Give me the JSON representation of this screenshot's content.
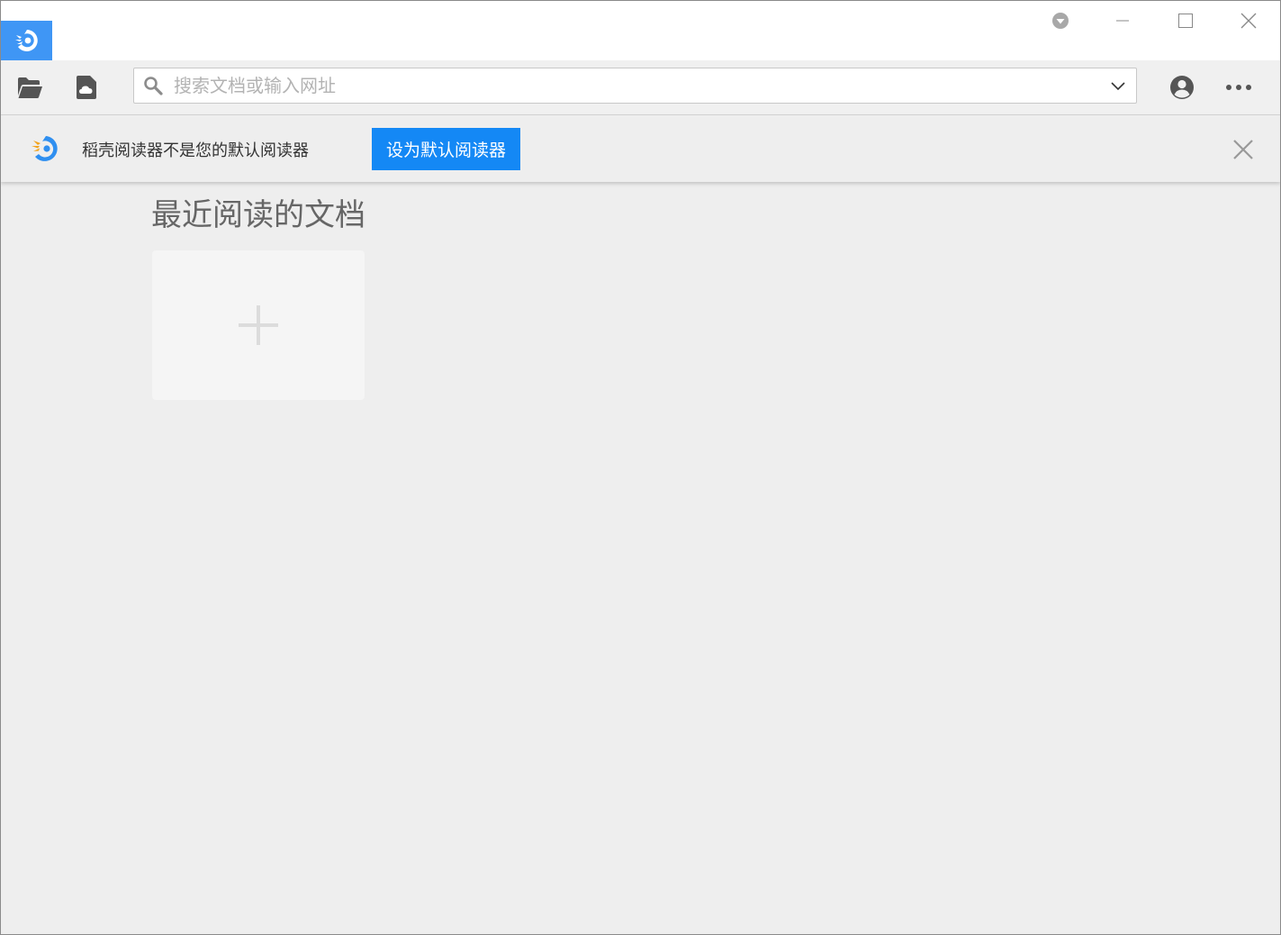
{
  "app": {
    "name": "稻壳阅读器",
    "brand_color": "#3f96f5",
    "accent_color": "#1488f5"
  },
  "titlebar": {
    "icons": [
      "app-logo-icon",
      "update-icon",
      "minimize-icon",
      "maximize-icon",
      "close-icon"
    ]
  },
  "toolbar": {
    "icons": [
      "open-folder-icon",
      "cloud-document-icon",
      "account-icon",
      "more-icon"
    ],
    "search": {
      "placeholder": "搜索文档或输入网址",
      "value": ""
    }
  },
  "notification": {
    "message": "稻壳阅读器不是您的默认阅读器",
    "button_label": "设为默认阅读器"
  },
  "main": {
    "section_title": "最近阅读的文档",
    "add_tile_icon": "plus-icon"
  }
}
